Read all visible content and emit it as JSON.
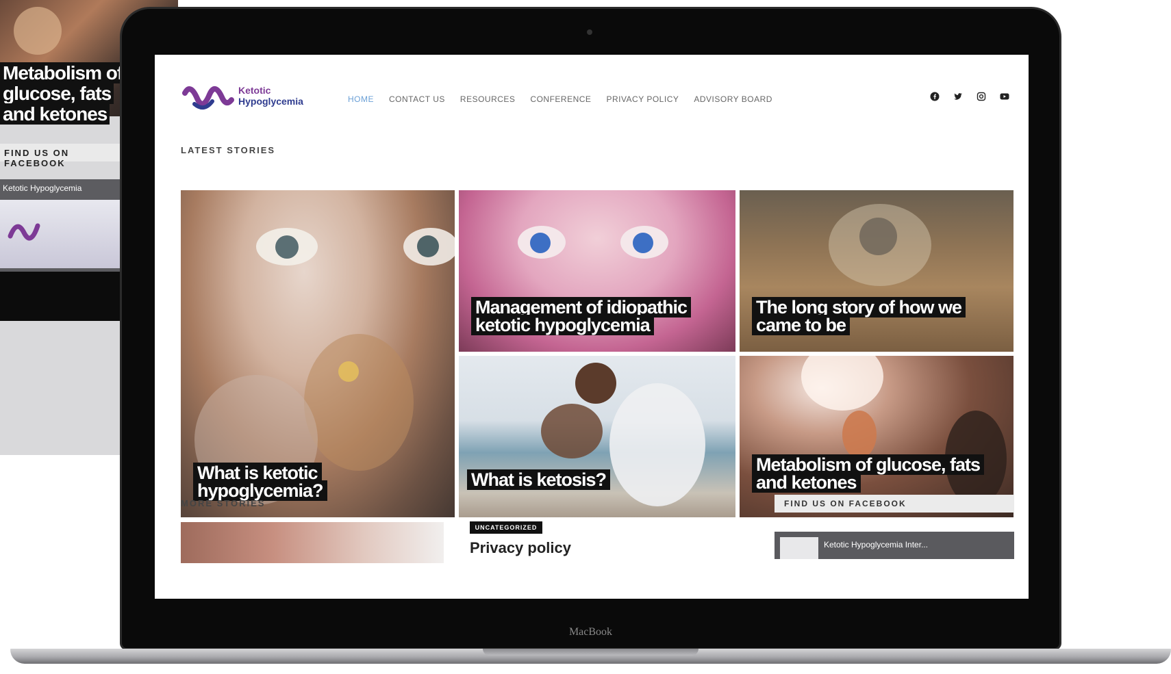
{
  "background_page": {
    "hero_title": "Metabolism of glucose, fats and ketones",
    "facebook_label": "FIND US ON FACEBOOK",
    "facebook_page_name": "Ketotic Hypoglycemia"
  },
  "laptop": {
    "bezel_label": "MacBook"
  },
  "site": {
    "logo_line1": "Ketotic",
    "logo_line2": "Hypoglycemia",
    "nav": [
      "HOME",
      "CONTACT US",
      "RESOURCES",
      "CONFERENCE",
      "PRIVACY POLICY",
      "ADVISORY BOARD"
    ],
    "social_icons": [
      "facebook-icon",
      "twitter-icon",
      "instagram-icon",
      "youtube-icon"
    ],
    "latest_label": "LATEST STORIES",
    "stories": [
      {
        "title": "What is ketotic hypoglycemia?"
      },
      {
        "title": "Management of idiopathic ketotic hypoglycemia"
      },
      {
        "title": "The long story of how we came to be"
      },
      {
        "title": "What is ketosis?"
      },
      {
        "title": "Metabolism of glucose, fats and ketones"
      }
    ],
    "more_label": "MORE STORIES",
    "more_story": {
      "category": "UNCATEGORIZED",
      "title": "Privacy policy"
    },
    "sidebar": {
      "facebook_label": "FIND US ON FACEBOOK",
      "facebook_page_name": "Ketotic Hypoglycemia Inter..."
    }
  },
  "colors": {
    "nav_active": "#6a9fd6",
    "logo_purple": "#7d3a96",
    "logo_blue": "#2f3c8f",
    "title_bg": "#111111"
  }
}
